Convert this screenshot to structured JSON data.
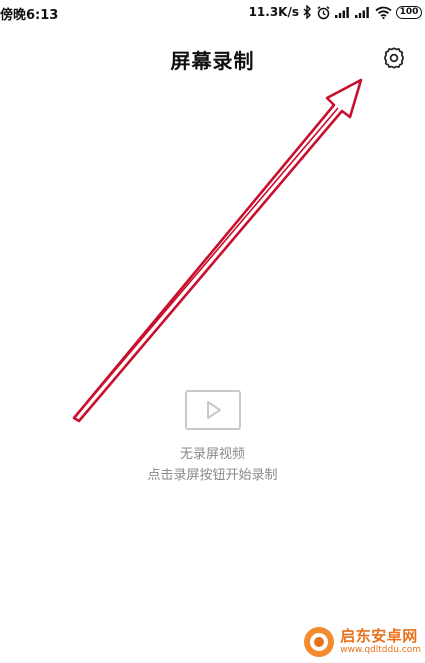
{
  "status_bar": {
    "time": "傍晚6:13",
    "net_speed": "11.3K/s",
    "battery": "100",
    "icons": [
      "bluetooth-icon",
      "alarm-icon",
      "signal-icon",
      "signal-icon",
      "wifi-icon",
      "battery-icon"
    ]
  },
  "header": {
    "title": "屏幕录制",
    "settings_icon": "gear-icon"
  },
  "empty_state": {
    "icon": "play-icon",
    "title": "无录屏视频",
    "hint": "点击录屏按钮开始录制"
  },
  "annotation": {
    "type": "arrow",
    "color": "#c8102e",
    "points_to": "settings-button"
  },
  "watermark": {
    "name": "启东安卓网",
    "url": "www.qdltddu.com",
    "accent_color": "#e8721c"
  }
}
